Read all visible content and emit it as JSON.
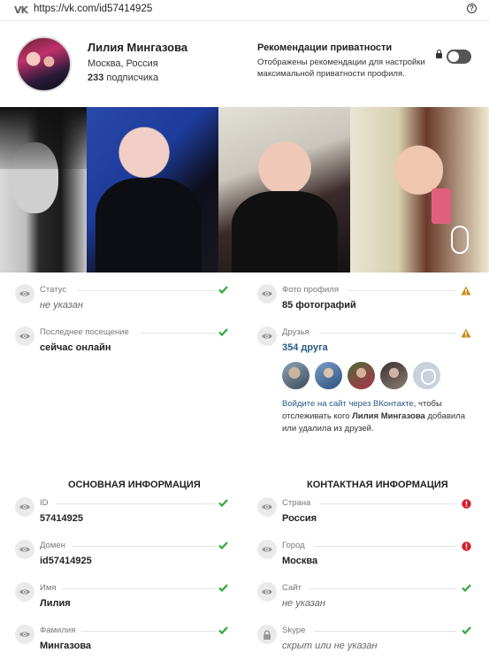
{
  "browser": {
    "logo": "VK",
    "url": "https://vk.com/id57414925"
  },
  "profile": {
    "name": "Лилия Мингазова",
    "location": "Москва, Россия",
    "subscribers_count": "233",
    "subscribers_label": " подписчика"
  },
  "privacy": {
    "title": "Рекомендации приватности",
    "description": "Отображены рекомендации для настройки максимальной приватности профиля.",
    "toggle_on": false
  },
  "left_fields": [
    {
      "label": "Статус",
      "value": "не указан",
      "muted": true,
      "status": "ok"
    },
    {
      "label": "Последнее посещение",
      "value": "сейчас онлайн",
      "muted": false,
      "status": "ok"
    }
  ],
  "right_fields": [
    {
      "label": "Фото профиля",
      "value": "85 фотографий",
      "muted": false,
      "status": "warning"
    },
    {
      "label": "Друзья",
      "value": "354 друга",
      "muted": false,
      "status": "warning"
    }
  ],
  "friends_note": {
    "link": "Войдите на сайт через ВКонтакте",
    "text1": ", чтобы отслеживать кого ",
    "name": "Лилия Мингазова",
    "text2": " добавила или удалила из друзей."
  },
  "sections": {
    "basic_title": "ОСНОВНАЯ ИНФОРМАЦИЯ",
    "contact_title": "КОНТАКТНАЯ ИНФОРМАЦИЯ"
  },
  "basic_fields": [
    {
      "label": "ID",
      "value": "57414925",
      "muted": false,
      "status": "ok"
    },
    {
      "label": "Домен",
      "value": "id57414925",
      "muted": false,
      "status": "ok"
    },
    {
      "label": "Имя",
      "value": "Лилия",
      "muted": false,
      "status": "ok"
    },
    {
      "label": "Фамилия",
      "value": "Мингазова",
      "muted": false,
      "status": "ok"
    }
  ],
  "contact_fields": [
    {
      "label": "Страна",
      "value": "Россия",
      "muted": false,
      "status": "error",
      "icon": "eye-icon"
    },
    {
      "label": "Город",
      "value": "Москва",
      "muted": false,
      "status": "error",
      "icon": "eye-icon"
    },
    {
      "label": "Сайт",
      "value": "не указан",
      "muted": true,
      "status": "ok",
      "icon": "eye-icon"
    },
    {
      "label": "Skype",
      "value": "скрыт или не указан",
      "muted": true,
      "status": "ok",
      "icon": "lock-icon"
    }
  ],
  "colors": {
    "ok": "#2eaa3a",
    "warning": "#c98a1b",
    "error": "#d21f2a",
    "link": "#2a5885"
  }
}
